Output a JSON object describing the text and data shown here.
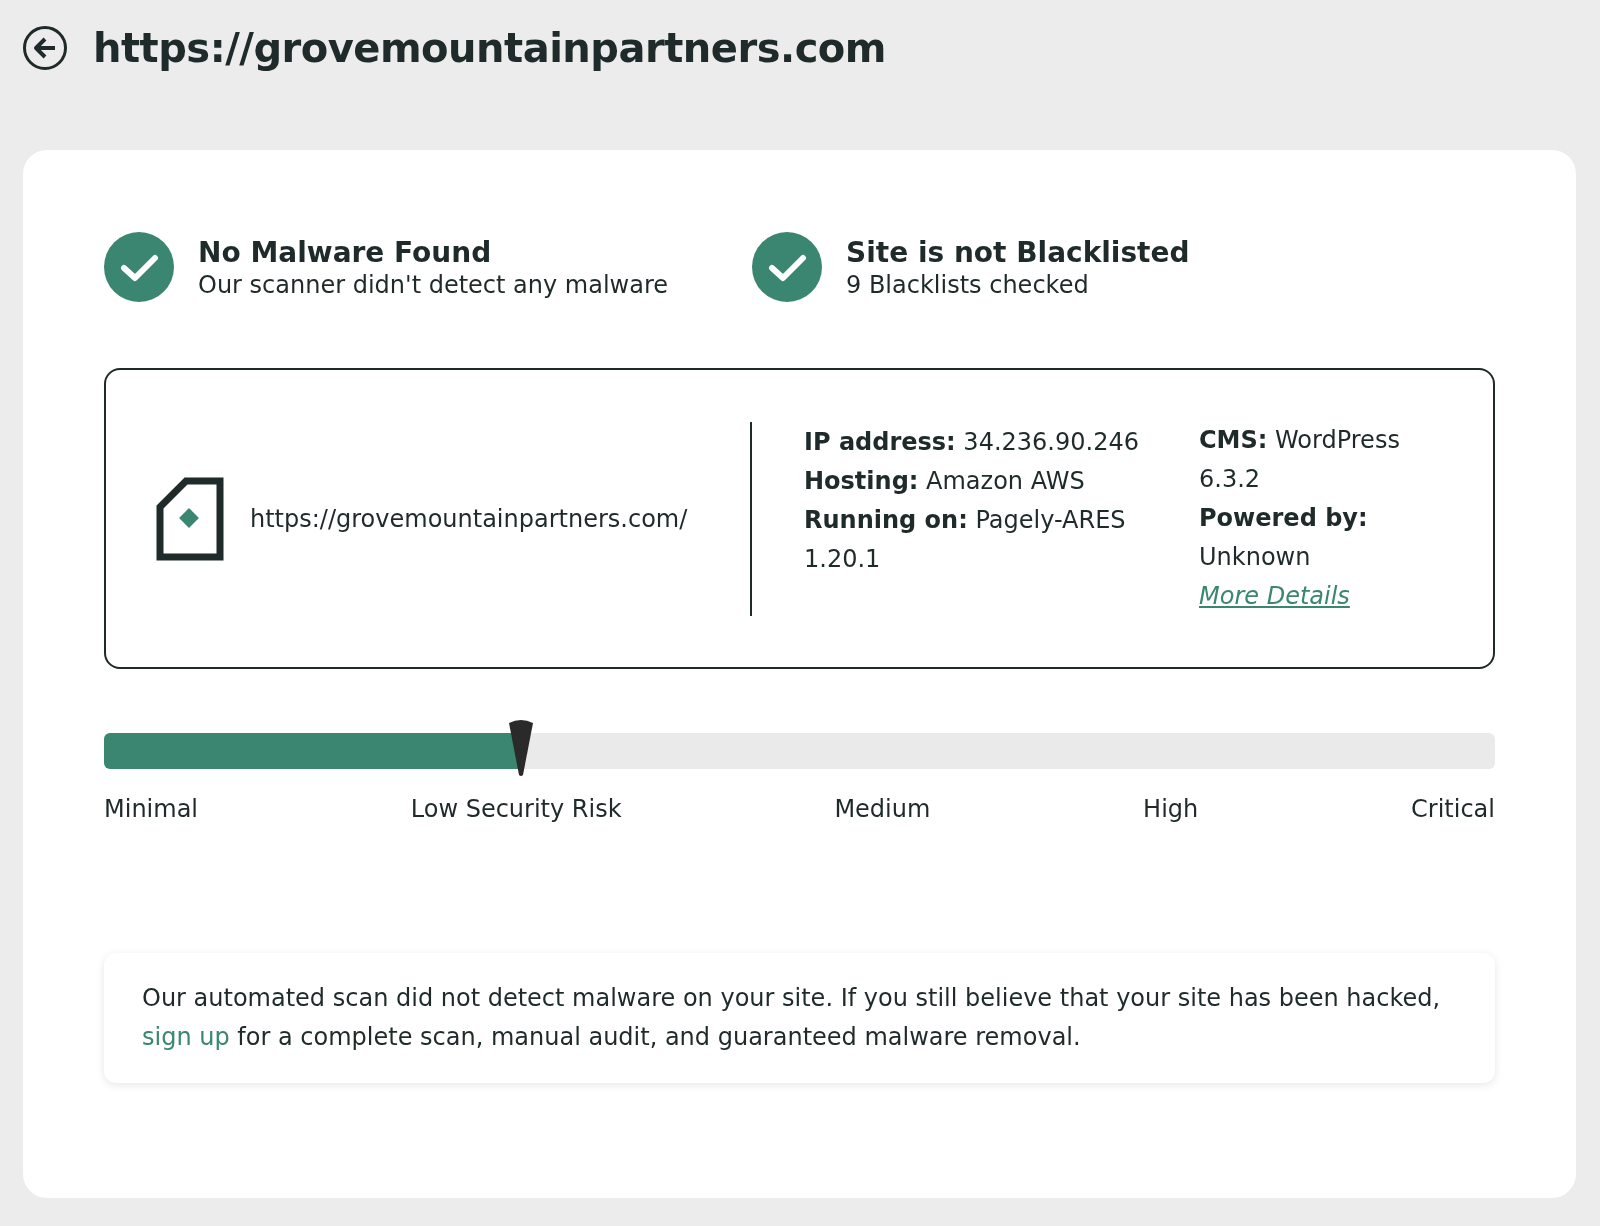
{
  "header": {
    "title": "https://grovemountainpartners.com"
  },
  "status_items": [
    {
      "title": "No Malware Found",
      "subtitle": "Our scanner didn't detect any malware",
      "ok": true
    },
    {
      "title": "Site is not Blacklisted",
      "subtitle": "9 Blacklists checked",
      "ok": true
    }
  ],
  "site_info": {
    "url": "https://grovemountainpartners.com/",
    "columns": [
      [
        {
          "label": "IP address:",
          "value": "34.236.90.246"
        },
        {
          "label": "Hosting:",
          "value": "Amazon AWS"
        },
        {
          "label": "Running on:",
          "value": "Pagely-ARES 1.20.1"
        }
      ],
      [
        {
          "label": "CMS:",
          "value": "WordPress 6.3.2"
        },
        {
          "label": "Powered by:",
          "value": "Unknown"
        }
      ]
    ],
    "more_details": "More Details"
  },
  "risk_meter": {
    "level": 0.3,
    "labels": [
      "Minimal",
      "Low Security Risk",
      "Medium",
      "High",
      "Critical"
    ]
  },
  "note": {
    "before": "Our automated scan did not detect malware on your site. If you still believe that your site has been hacked,",
    "link": "sign up",
    "after": "for a complete scan, manual audit, and guaranteed malware removal."
  }
}
